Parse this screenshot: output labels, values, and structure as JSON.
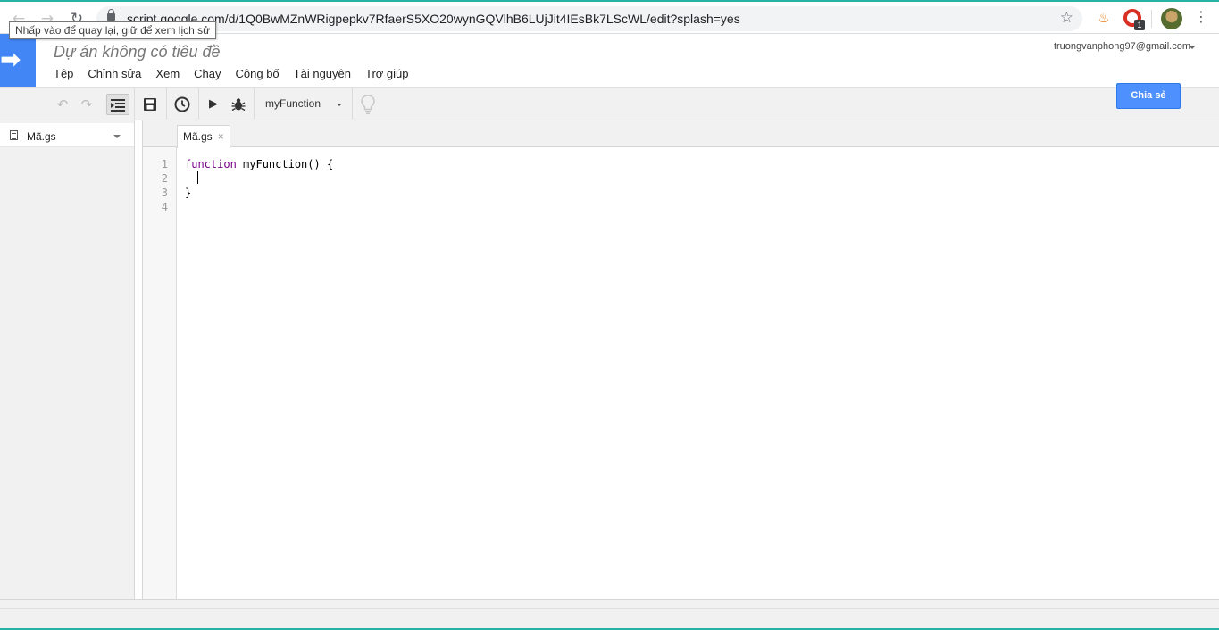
{
  "browser": {
    "url": "script.google.com/d/1Q0BwMZnWRigpepkv7RfaerS5XO20wynGQVlhB6LUjJit4IEsBk7LScWL/edit?splash=yes",
    "tooltip": "Nhấp vào để quay lại, giữ để xem lịch sử",
    "extension_badge": "1"
  },
  "app": {
    "title": "Dự án không có tiêu đề",
    "account": "truongvanphong97@gmail.com",
    "share_label": "Chia sẻ",
    "menu": [
      "Tệp",
      "Chỉnh sửa",
      "Xem",
      "Chạy",
      "Công bố",
      "Tài nguyên",
      "Trợ giúp"
    ]
  },
  "toolbar": {
    "function_select": "myFunction"
  },
  "files": {
    "items": [
      {
        "name": "Mã.gs"
      }
    ]
  },
  "editor": {
    "tab_label": "Mã.gs",
    "line_numbers": [
      "1",
      "2",
      "3",
      "4"
    ],
    "lines": {
      "l1_keyword": "function",
      "l1_rest": " myFunction() {",
      "l2": "",
      "l3": "}",
      "l4": ""
    }
  },
  "colors": {
    "accent": "#4285f4",
    "share_button": "#4d90fe",
    "keyword": "#770088"
  }
}
